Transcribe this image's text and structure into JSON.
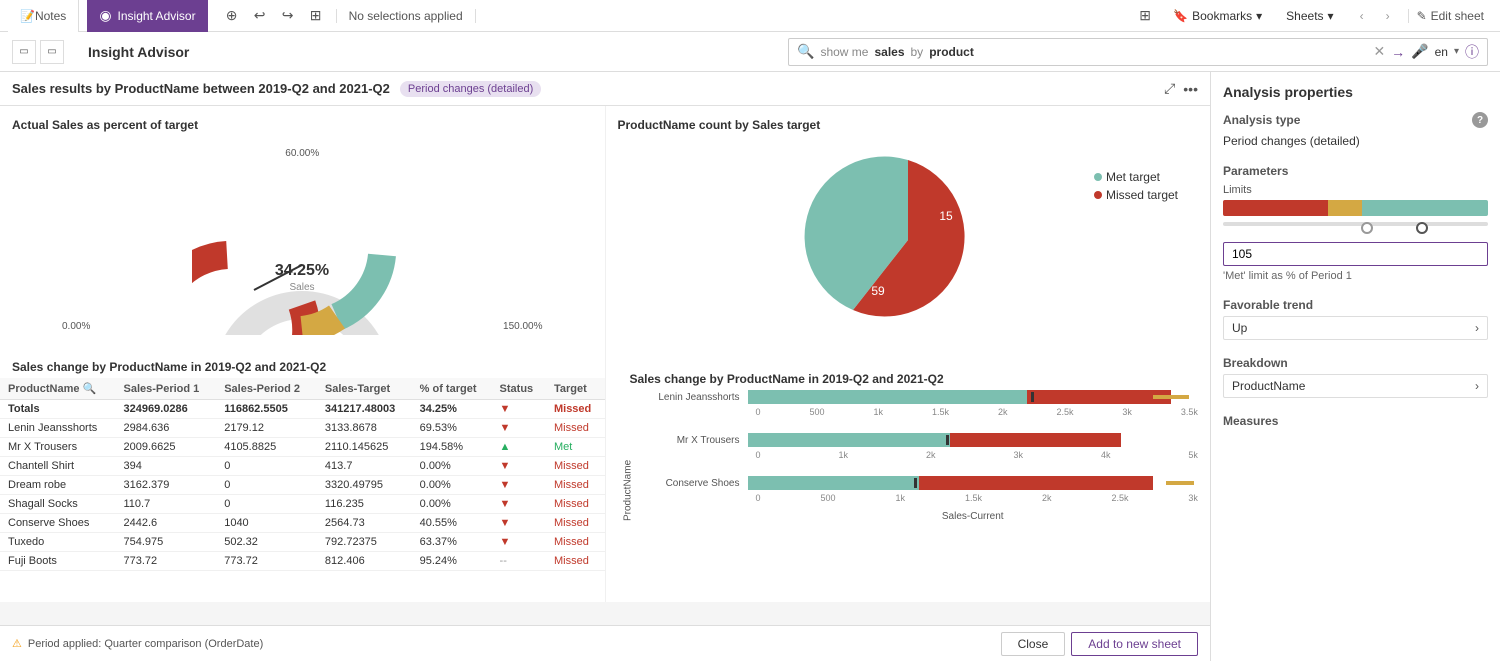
{
  "topToolbar": {
    "notesTab": "Notes",
    "insightTab": "Insight Advisor",
    "noSelections": "No selections applied",
    "bookmarks": "Bookmarks",
    "sheets": "Sheets",
    "editSheet": "Edit sheet"
  },
  "secondToolbar": {
    "appTitle": "Insight Advisor",
    "searchPlaceholder": "show me sales by product",
    "searchPrefix": "show me ",
    "searchBold": "sales",
    "searchSuffix": " by ",
    "searchBold2": "product",
    "lang": "en"
  },
  "results": {
    "title": "Sales results by ProductName between 2019-Q2 and 2021-Q2",
    "badge": "Period changes (detailed)"
  },
  "donutChart": {
    "title": "Actual Sales as percent of target",
    "centerPct": "34.25%",
    "centerLabel": "Sales",
    "labelLeft": "0.00%",
    "labelRight": "150.00%",
    "labelTop": "60.00%"
  },
  "pieChart": {
    "title": "ProductName count by Sales target",
    "metLabel": "Met target",
    "metValue": "15",
    "missedLabel": "Missed target",
    "missedValue": "59"
  },
  "tableSection": {
    "title": "Sales change by ProductName in 2019-Q2 and 2021-Q2",
    "columns": [
      "ProductName",
      "Sales-Period 1",
      "Sales-Period 2",
      "Sales-Target",
      "% of target",
      "Status",
      "Target"
    ],
    "totals": {
      "name": "Totals",
      "period1": "324969.0286",
      "period2": "116862.5505",
      "target": "341217.48003",
      "pct": "34.25%",
      "trend": "▼",
      "status": "Missed"
    },
    "rows": [
      {
        "name": "Lenin Jeansshorts",
        "period1": "2984.636",
        "period2": "2179.12",
        "target": "3133.8678",
        "pct": "69.53%",
        "trend": "▼",
        "status": "Missed"
      },
      {
        "name": "Mr X Trousers",
        "period1": "2009.6625",
        "period2": "4105.8825",
        "target": "2110.145625",
        "pct": "194.58%",
        "trend": "▲",
        "status": "Met"
      },
      {
        "name": "Chantell Shirt",
        "period1": "394",
        "period2": "0",
        "target": "413.7",
        "pct": "0.00%",
        "trend": "▼",
        "status": "Missed"
      },
      {
        "name": "Dream robe",
        "period1": "3162.379",
        "period2": "0",
        "target": "3320.49795",
        "pct": "0.00%",
        "trend": "▼",
        "status": "Missed"
      },
      {
        "name": "Shagall Socks",
        "period1": "110.7",
        "period2": "0",
        "target": "116.235",
        "pct": "0.00%",
        "trend": "▼",
        "status": "Missed"
      },
      {
        "name": "Conserve Shoes",
        "period1": "2442.6",
        "period2": "1040",
        "target": "2564.73",
        "pct": "40.55%",
        "trend": "▼",
        "status": "Missed"
      },
      {
        "name": "Tuxedo",
        "period1": "754.975",
        "period2": "502.32",
        "target": "792.72375",
        "pct": "63.37%",
        "trend": "▼",
        "status": "Missed"
      },
      {
        "name": "Fuji Boots",
        "period1": "773.72",
        "period2": "773.72",
        "target": "812.406",
        "pct": "95.24%",
        "trend": "--",
        "status": "Missed"
      }
    ]
  },
  "barSection": {
    "title": "Sales change by ProductName in 2019-Q2 and 2021-Q2",
    "yAxisLabel": "ProductName",
    "xAxisLabel": "Sales-Current",
    "bars": [
      {
        "label": "Lenin Jeansshorts",
        "axes": [
          "0",
          "500",
          "1k",
          "1.5k",
          "2k",
          "2.5k",
          "3k",
          "3.5k"
        ],
        "teal": 62,
        "red": 32
      },
      {
        "label": "Mr X Trousers",
        "axes": [
          "0",
          "1k",
          "2k",
          "3k",
          "4k",
          "5k"
        ],
        "teal": 45,
        "red": 38
      },
      {
        "label": "Conserve Shoes",
        "axes": [
          "0",
          "500",
          "1k",
          "1.5k",
          "2k",
          "2.5k",
          "3k"
        ],
        "teal": 38,
        "red": 52
      }
    ]
  },
  "rightPanel": {
    "heading": "Analysis properties",
    "analysisTypeLabel": "Analysis type",
    "helpIcon": "?",
    "analysisTypeValue": "Period changes (detailed)",
    "parametersLabel": "Parameters",
    "limitsLabel": "Limits",
    "limitsInputValue": "105",
    "limitsDesc": "'Met' limit as % of Period 1",
    "favorableTrendLabel": "Favorable trend",
    "favorableTrendValue": "Up",
    "breakdownLabel": "Breakdown",
    "breakdownValue": "ProductName",
    "measuresLabel": "Measures"
  },
  "footer": {
    "periodText": "Period applied:  Quarter comparison (OrderDate)",
    "closeBtn": "Close",
    "addSheetBtn": "Add to new sheet"
  }
}
